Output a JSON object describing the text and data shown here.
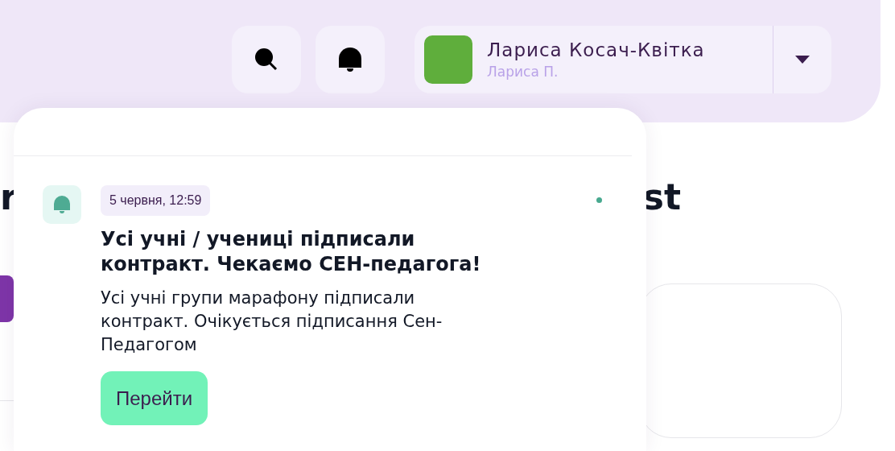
{
  "header": {
    "user": {
      "name": "Лариса Косач-Квітка",
      "short_name": "Лариса П."
    }
  },
  "page": {
    "heading_fragments": [
      "r",
      "st"
    ]
  },
  "notifications_popup": {
    "items": [
      {
        "date": "5 червня, 12:59",
        "unread": true,
        "title": "Усі учні / учениці підписали контракт. Чекаємо СЕН-педагога!",
        "body": "Усі учні групи марафону підписали контракт. Очікується підписання Сен-Педагогом",
        "action": "Перейти"
      }
    ]
  }
}
